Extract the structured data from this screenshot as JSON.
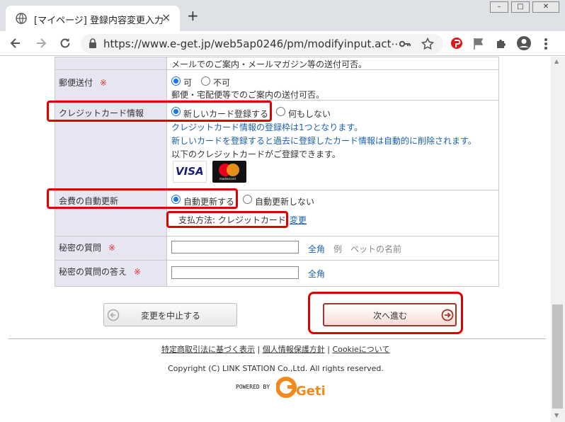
{
  "browser": {
    "tab_title": "[マイページ] 登録内容変更入力",
    "url": "https://www.e-get.jp/web5ap0246/pm/modifyinput.act⋯",
    "close_glyph": "×",
    "new_tab_glyph": "+",
    "win_min": "–",
    "win_max": "□",
    "win_close": "✕"
  },
  "form": {
    "top_note": "メールでのご案内・メールマガジン等の送付可否。",
    "postal": {
      "label": "郵便送付",
      "required_mark": "※",
      "opt_yes": "可",
      "opt_no": "不可",
      "selected": "可",
      "note": "郵便・宅配便等でのご案内の送付可否。"
    },
    "credit": {
      "label": "クレジットカード情報",
      "opt_new": "新しいカード登録する",
      "opt_none": "何もしない",
      "selected": "新しいカード登録する",
      "note1": "クレジットカード情報の登録枠は1つとなります。",
      "note2": "新しいカードを登録すると過去に登録したカード情報は自動的に削除されます。",
      "note3": "以下のクレジットカードがご登録できます。",
      "visa": "VISA",
      "mastercard": "mastercard"
    },
    "renewal": {
      "label": "会費の自動更新",
      "opt_auto": "自動更新する",
      "opt_manual": "自動更新しない",
      "selected": "自動更新する",
      "payment": "支払方法: クレジットカード",
      "change_link": "変更"
    },
    "secret_q": {
      "label": "秘密の質問",
      "required_mark": "※",
      "value": "",
      "hint_zen": "全角",
      "hint_example": "例　ペットの名前"
    },
    "secret_a": {
      "label": "秘密の質問の答え",
      "required_mark": "※",
      "value": "",
      "hint_zen": "全角"
    }
  },
  "buttons": {
    "cancel": "変更を中止する",
    "next": "次へ進む"
  },
  "footer": {
    "link1": "特定商取引法に基づく表示",
    "link2": "個人情報保護方針",
    "link3": "Cookieについて",
    "sep": "|",
    "copyright": "Copyright (C) LINK STATION Co.,Ltd. All rights reserved.",
    "powered_by": "POWERED BY",
    "logo_text": "Getii"
  },
  "colors": {
    "highlight": "#e00000",
    "link_blue": "#1a5fb4",
    "label_bg": "#e6e6f2"
  }
}
